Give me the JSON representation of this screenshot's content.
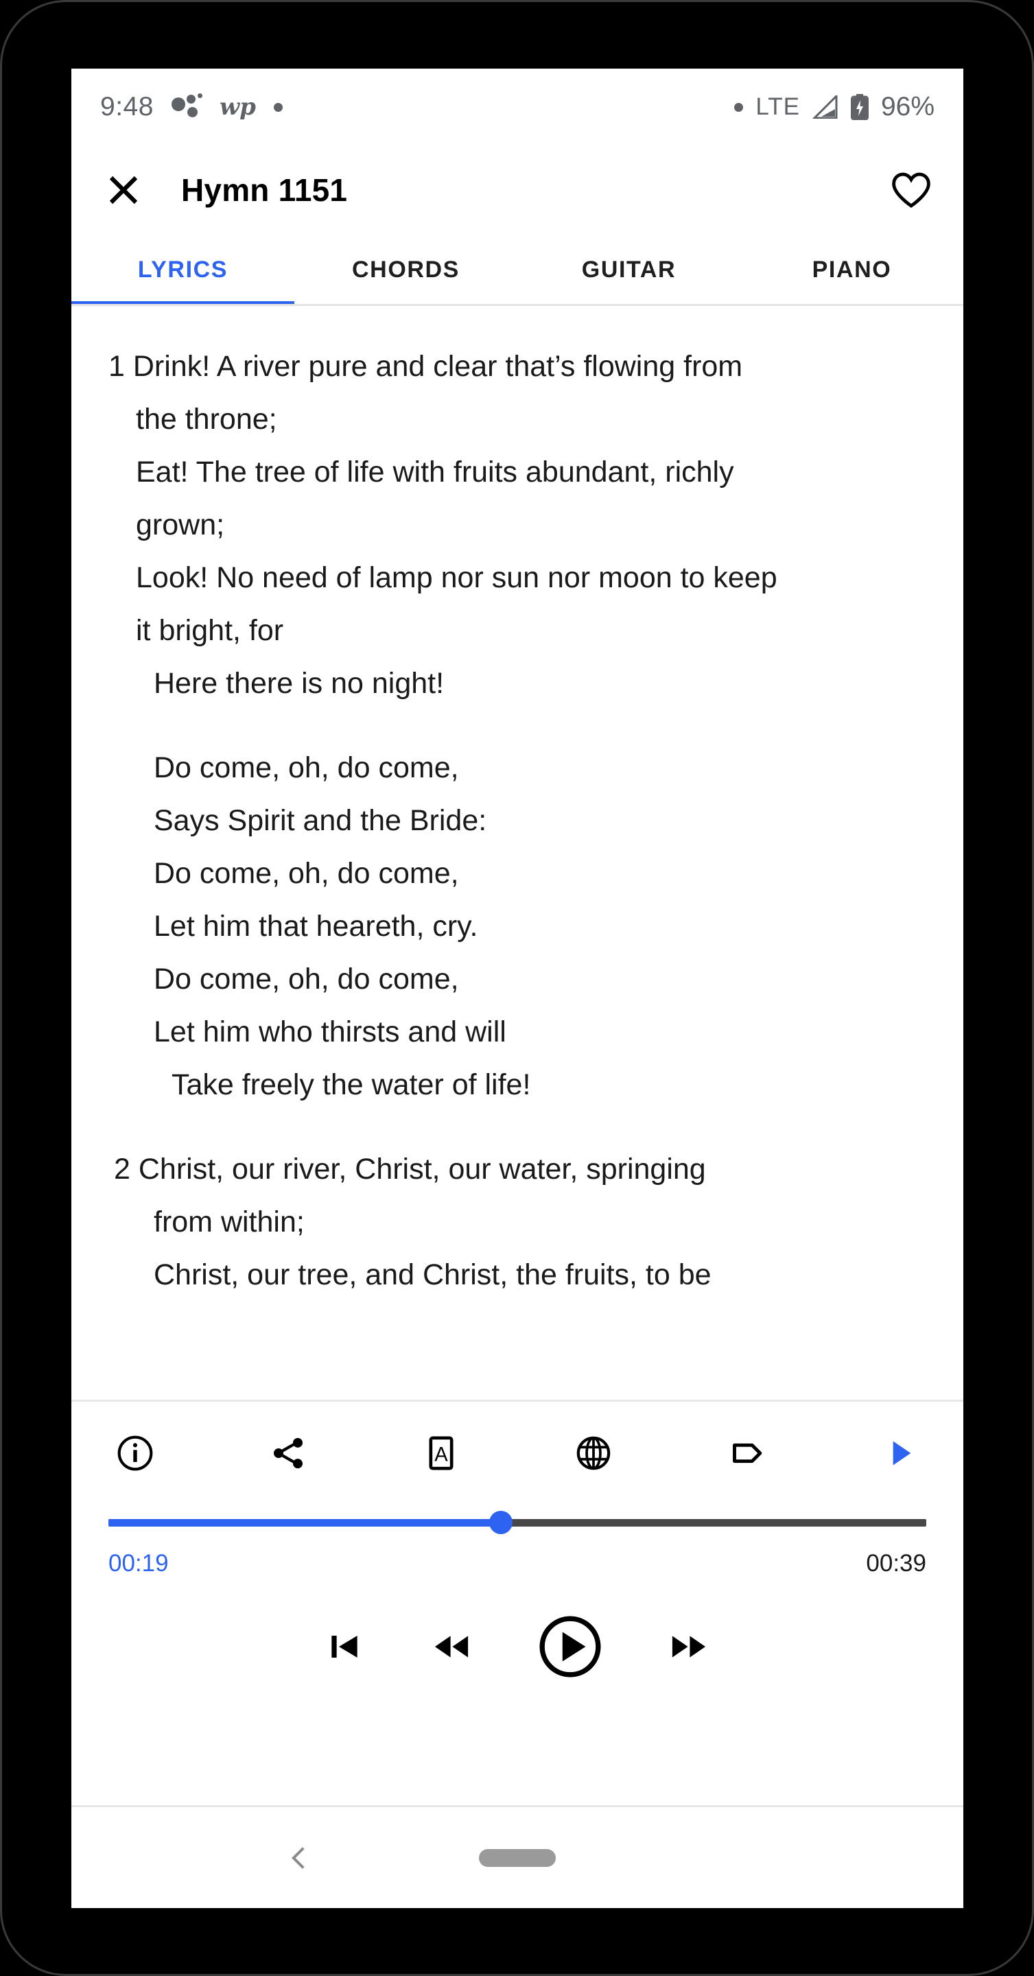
{
  "status_bar": {
    "time": "9:48",
    "notification_icons": [
      "dots-notification-icon",
      "wp-washington-post-icon",
      "dot-notification-icon"
    ],
    "wp_label": "wp",
    "network_label": "LTE",
    "signal_icon": "signal-triangle-icon",
    "battery_icon": "battery-charging-icon",
    "battery_percent": "96%"
  },
  "app_bar": {
    "close_icon": "close-icon",
    "title": "Hymn 1151",
    "favorite_icon": "heart-outline-icon"
  },
  "tabs": {
    "active_index": 0,
    "items": [
      {
        "label": "LYRICS"
      },
      {
        "label": "CHORDS"
      },
      {
        "label": "GUITAR"
      },
      {
        "label": "PIANO"
      }
    ],
    "indicator_color": "#2d63f0"
  },
  "lyrics": {
    "verses": [
      {
        "lines": [
          {
            "text": "1 Drink! A river pure and clear that’s flowing from",
            "indent": 0
          },
          {
            "text": "the throne;",
            "indent": 1
          },
          {
            "text": "Eat! The tree of life with fruits abundant, richly",
            "indent": 1
          },
          {
            "text": "grown;",
            "indent": 1
          },
          {
            "text": "Look! No need of lamp nor sun nor moon to keep",
            "indent": 1
          },
          {
            "text": "it bright, for",
            "indent": 1
          },
          {
            "text": "Here there is no night!",
            "indent": 2
          }
        ]
      },
      {
        "lines": [
          {
            "text": "Do come, oh, do come,",
            "indent": 2
          },
          {
            "text": "Says Spirit and the Bride:",
            "indent": 2
          },
          {
            "text": "Do come, oh, do come,",
            "indent": 2
          },
          {
            "text": "Let him that heareth, cry.",
            "indent": 2
          },
          {
            "text": "Do come, oh, do come,",
            "indent": 2
          },
          {
            "text": "Let him who thirsts and will",
            "indent": 2
          },
          {
            "text": "Take freely the water of life!",
            "indent": 3
          }
        ]
      },
      {
        "lines": [
          {
            "text": "2 Christ, our river, Christ, our water, springing",
            "indent": 0
          },
          {
            "text": "from within;",
            "indent": 1
          },
          {
            "text": "Christ, our tree, and Christ, the fruits, to be",
            "indent": 1
          }
        ]
      }
    ]
  },
  "player": {
    "actions": [
      {
        "name": "info-icon"
      },
      {
        "name": "share-icon"
      },
      {
        "name": "font-size-icon"
      },
      {
        "name": "globe-icon"
      },
      {
        "name": "tag-icon"
      },
      {
        "name": "play-arrow-icon"
      }
    ],
    "progress_percent": 48,
    "time_current": "00:19",
    "time_total": "00:39",
    "accent_color": "#2d63f0",
    "track_color": "#474747",
    "transport": [
      {
        "name": "skip-previous-icon"
      },
      {
        "name": "rewind-icon"
      },
      {
        "name": "play-circle-icon"
      },
      {
        "name": "fast-forward-icon"
      }
    ]
  },
  "nav_bar": {
    "back_icon": "back-chevron-icon",
    "home_icon": "home-pill-icon"
  }
}
